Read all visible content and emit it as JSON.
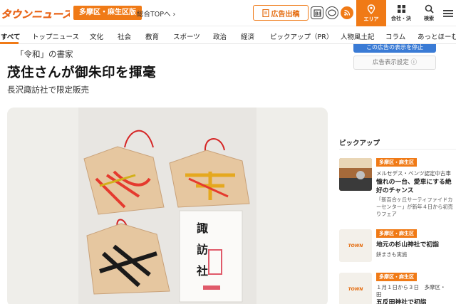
{
  "header": {
    "logo_text": "タウンニュース",
    "region_button": "多摩区・麻生区版",
    "top_link": "総合TOPへ ›",
    "ad_button": "広告出稿",
    "area_label": "エリア",
    "company_label": "会社・決",
    "search_label": "検索"
  },
  "nav": {
    "items": [
      "すべて",
      "トップニュース",
      "文化",
      "社会",
      "教育",
      "スポーツ",
      "政治",
      "経済",
      "ピックアップ（PR）",
      "人物風土記",
      "コラム",
      "あっとほーむ"
    ]
  },
  "article": {
    "kicker": "「令和」の書家",
    "title": "茂住さんが御朱印を揮毫",
    "subtitle": "長沢諏訪社で限定販売"
  },
  "sidebar": {
    "ad_remove_label": "この広告の表示を停止",
    "ad_settings_label": "広告表示設定 ⓘ",
    "pickup_title": "ピックアップ",
    "pickups": [
      {
        "badge": "多摩区・麻生区",
        "subtitle": "メルセデス・ベンツ認定中古車",
        "headline": "憧れの一台、愛車にする絶好のチャンス",
        "note": "「新百合ヶ丘サーティファイドカーセンター」が新年４日から初売りフェア"
      },
      {
        "badge": "多摩区・麻生区",
        "headline": "地元の杉山神社で初詣",
        "note": "餅まきも実施"
      },
      {
        "badge": "多摩区・麻生区",
        "subtitle": "１月１日から３日　多摩区・",
        "subtitle2": "田",
        "headline": "五反田神社で初詣"
      }
    ]
  },
  "colors": {
    "brand_orange": "#f07a16",
    "ad_blue": "#3a7bd5"
  }
}
